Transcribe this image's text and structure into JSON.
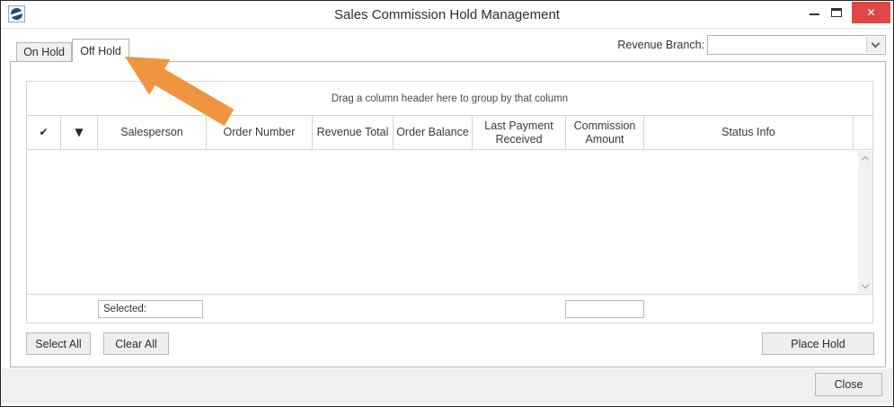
{
  "window": {
    "title": "Sales Commission Hold Management",
    "close_glyph": "✕"
  },
  "header": {
    "revenue_branch_label": "Revenue Branch:",
    "revenue_branch_value": ""
  },
  "tabs": {
    "on_hold": {
      "label": "On Hold",
      "active": false
    },
    "off_hold": {
      "label": "Off Hold",
      "active": true
    }
  },
  "grid": {
    "group_hint": "Drag a column header here to group by that column",
    "columns": {
      "check_icon": "✔",
      "select_icon": "▼",
      "salesperson": "Salesperson",
      "order_number": "Order Number",
      "revenue_total": "Revenue Total",
      "order_balance": "Order Balance",
      "last_payment": "Last Payment Received",
      "commission_amount": "Commission Amount",
      "status_info": "Status Info"
    },
    "rows": [],
    "footer": {
      "selected_label": "Selected:",
      "selected_value": "",
      "commission_total_value": ""
    }
  },
  "actions": {
    "select_all": "Select All",
    "clear_all": "Clear All",
    "place_hold": "Place Hold",
    "close": "Close"
  },
  "annotation": {
    "arrow_target": "off-hold-tab",
    "arrow_color": "#F0943F"
  },
  "colors": {
    "close_button": "#E04747",
    "grid_border": "#D5D5D5",
    "tab_border": "#B2B2B2"
  }
}
